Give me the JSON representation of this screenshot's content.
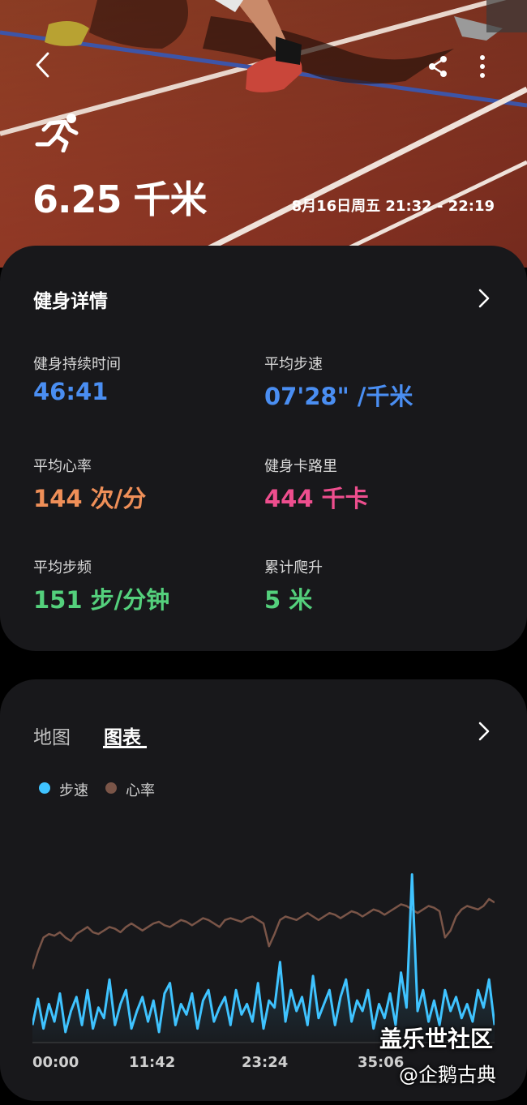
{
  "header": {
    "distance": "6.25 千米",
    "date_time": "8月16日周五 21:32 - 22:19",
    "icons": {
      "back": "back-chevron-icon",
      "share": "share-icon",
      "more": "more-vertical-icon",
      "activity": "running-person-icon"
    }
  },
  "details": {
    "title": "健身详情",
    "stats": [
      {
        "label": "健身持续时间",
        "value": "46:41",
        "color": "#4a8ef2"
      },
      {
        "label": "平均步速",
        "value": "07'28\" /千米",
        "color": "#4a8ef2"
      },
      {
        "label": "平均心率",
        "value": "144 次/分",
        "color": "#ef8f58"
      },
      {
        "label": "健身卡路里",
        "value": "444 千卡",
        "color": "#ee4e8e"
      },
      {
        "label": "平均步频",
        "value": "151 步/分钟",
        "color": "#54d07c"
      },
      {
        "label": "累计爬升",
        "value": "5 米",
        "color": "#54d07c"
      }
    ]
  },
  "chart_card": {
    "tabs": [
      {
        "label": "地图",
        "active": false
      },
      {
        "label": "图表",
        "active": true
      }
    ],
    "legend": [
      {
        "label": "步速",
        "color": "#3fc3ff"
      },
      {
        "label": "心率",
        "color": "#7a5548"
      }
    ]
  },
  "chart_data": {
    "type": "line",
    "x_ticks": [
      "00:00",
      "11:42",
      "23:24",
      "35:06"
    ],
    "series": [
      {
        "name": "心率",
        "color": "#7a5548",
        "values": [
          0.42,
          0.52,
          0.6,
          0.62,
          0.61,
          0.63,
          0.6,
          0.58,
          0.62,
          0.64,
          0.66,
          0.63,
          0.62,
          0.64,
          0.66,
          0.65,
          0.63,
          0.66,
          0.68,
          0.66,
          0.64,
          0.66,
          0.68,
          0.69,
          0.67,
          0.66,
          0.68,
          0.7,
          0.69,
          0.67,
          0.69,
          0.71,
          0.7,
          0.68,
          0.66,
          0.7,
          0.71,
          0.7,
          0.69,
          0.71,
          0.72,
          0.7,
          0.68,
          0.55,
          0.62,
          0.7,
          0.72,
          0.71,
          0.7,
          0.72,
          0.74,
          0.72,
          0.7,
          0.72,
          0.74,
          0.73,
          0.71,
          0.73,
          0.75,
          0.74,
          0.72,
          0.74,
          0.76,
          0.75,
          0.73,
          0.75,
          0.77,
          0.79,
          0.78,
          0.76,
          0.74,
          0.76,
          0.78,
          0.77,
          0.75,
          0.6,
          0.64,
          0.72,
          0.76,
          0.78,
          0.77,
          0.76,
          0.78,
          0.82,
          0.8
        ]
      },
      {
        "name": "步速",
        "color": "#3fc3ff",
        "values": [
          0.1,
          0.25,
          0.08,
          0.22,
          0.12,
          0.28,
          0.06,
          0.18,
          0.26,
          0.1,
          0.3,
          0.08,
          0.2,
          0.14,
          0.36,
          0.1,
          0.22,
          0.3,
          0.08,
          0.18,
          0.26,
          0.12,
          0.24,
          0.06,
          0.28,
          0.34,
          0.1,
          0.22,
          0.16,
          0.28,
          0.08,
          0.24,
          0.3,
          0.12,
          0.2,
          0.26,
          0.1,
          0.3,
          0.16,
          0.22,
          0.12,
          0.34,
          0.08,
          0.24,
          0.2,
          0.46,
          0.12,
          0.3,
          0.18,
          0.26,
          0.1,
          0.38,
          0.14,
          0.22,
          0.3,
          0.1,
          0.26,
          0.36,
          0.12,
          0.24,
          0.18,
          0.3,
          0.08,
          0.22,
          0.14,
          0.28,
          0.1,
          0.4,
          0.2,
          0.96,
          0.18,
          0.3,
          0.12,
          0.24,
          0.1,
          0.3,
          0.18,
          0.26,
          0.14,
          0.22,
          0.12,
          0.3,
          0.2,
          0.36,
          0.1
        ]
      }
    ]
  },
  "watermark": {
    "line1": "盖乐世社区",
    "line2": "@企鹅古典"
  }
}
